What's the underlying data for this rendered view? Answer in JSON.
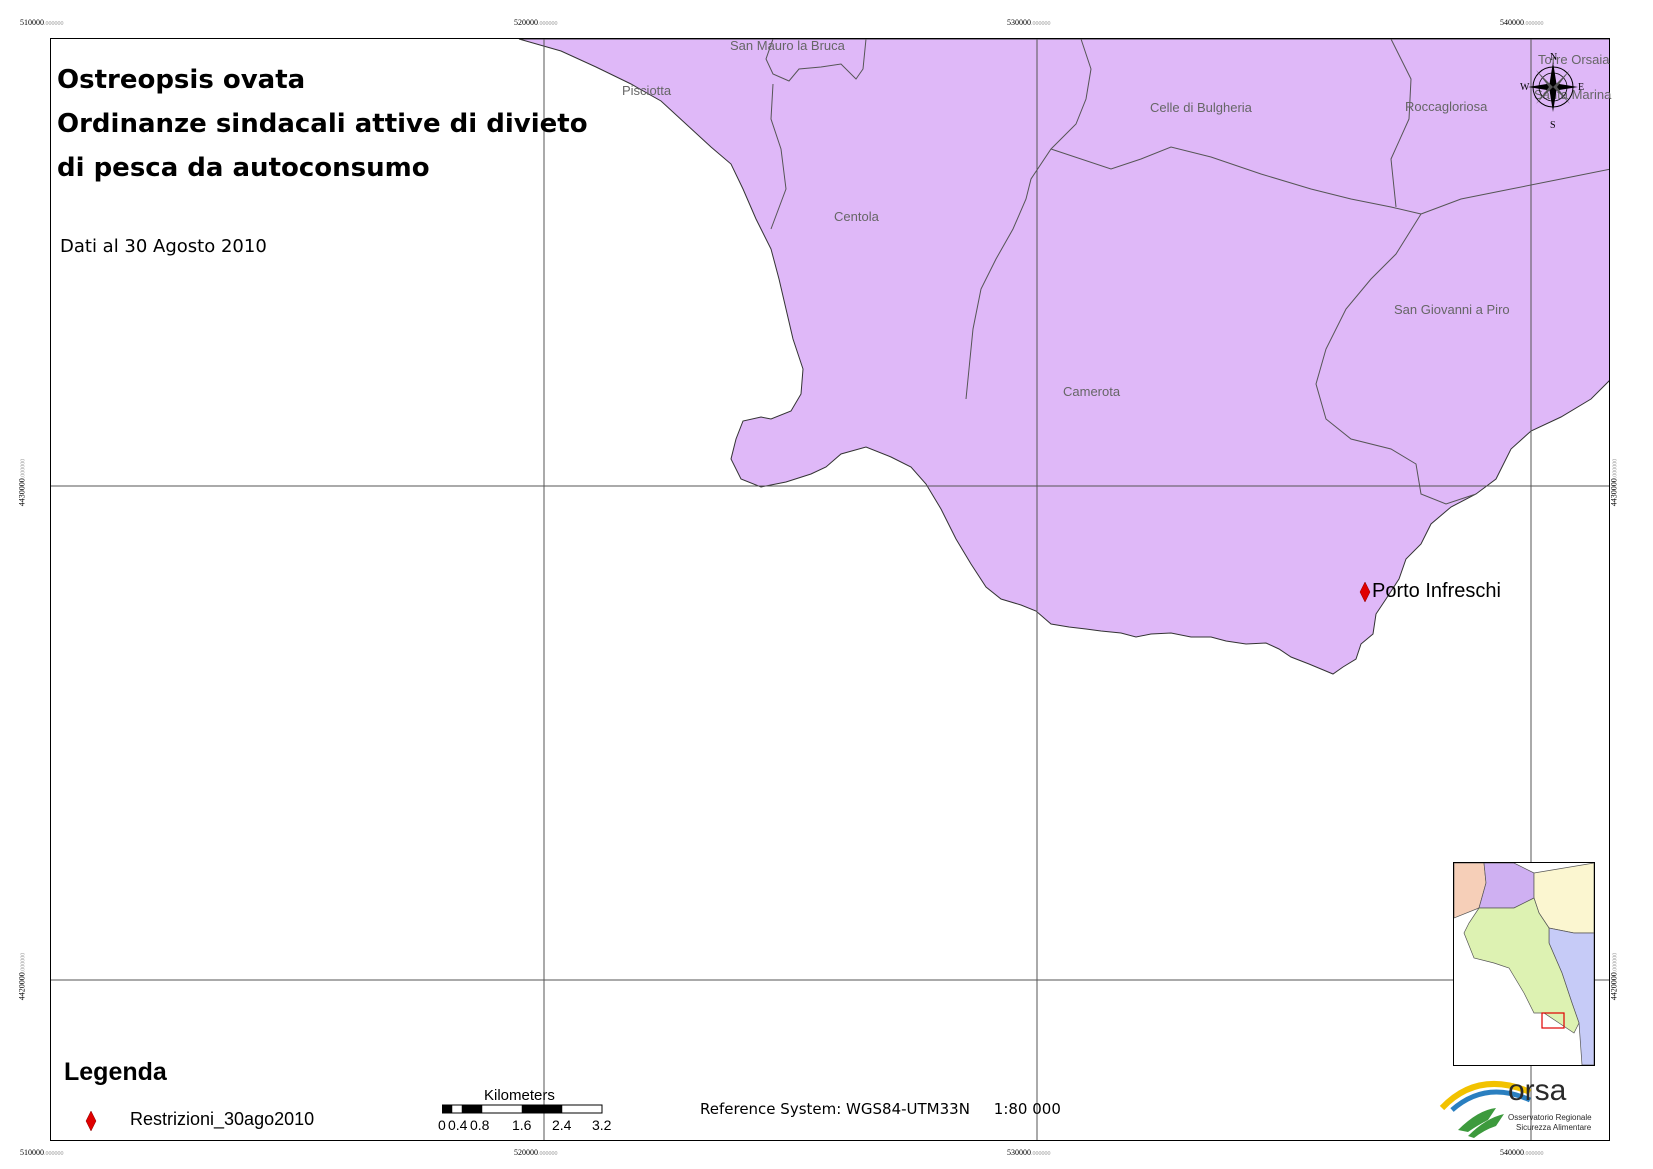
{
  "title": {
    "line1": "Ostreopsis ovata",
    "line2": "Ordinanze sindacali attive di divieto",
    "line3": "di pesca da autoconsumo"
  },
  "subtitle": "Dati al 30 Agosto 2010",
  "grid": {
    "x_labels": [
      {
        "main": "510000",
        "sub": ".000000"
      },
      {
        "main": "520000",
        "sub": ".000000"
      },
      {
        "main": "530000",
        "sub": ".000000"
      },
      {
        "main": "540000",
        "sub": ".000000"
      }
    ],
    "y_labels": [
      {
        "main": "4430000",
        "sub": ".000000"
      },
      {
        "main": "4420000",
        "sub": ".000000"
      }
    ]
  },
  "municipalities": [
    {
      "name": "San Mauro la Bruca"
    },
    {
      "name": "Pisciotta"
    },
    {
      "name": "Celle di Bulgheria"
    },
    {
      "name": "Roccagloriosa"
    },
    {
      "name": "Torre Orsaia"
    },
    {
      "name": "Santa Marina"
    },
    {
      "name": "Centola"
    },
    {
      "name": "San Giovanni a Piro"
    },
    {
      "name": "Camerota"
    }
  ],
  "point_of_interest": {
    "name": "Porto Infreschi",
    "color": "#e00000"
  },
  "legend": {
    "title": "Legenda",
    "items": [
      {
        "label": "Restrizioni_30ago2010",
        "symbol": "red-diamond"
      }
    ]
  },
  "scalebar": {
    "unit": "Kilometers",
    "ticks": [
      "0",
      "0.4",
      "0.8",
      "1.6",
      "2.4",
      "3.2"
    ]
  },
  "reference": {
    "system": "Reference System: WGS84-UTM33N",
    "scale": "1:80 000"
  },
  "compass": {
    "n": "N",
    "s": "S",
    "e": "E",
    "w": "W"
  },
  "logo": {
    "name": "orsa",
    "line1": "Osservatorio Regionale",
    "line2": "Sicurezza Alimentare"
  },
  "colors": {
    "land": "#dfb8f8",
    "boundary": "#555555",
    "grid": "#555555",
    "poi": "#e00000"
  }
}
